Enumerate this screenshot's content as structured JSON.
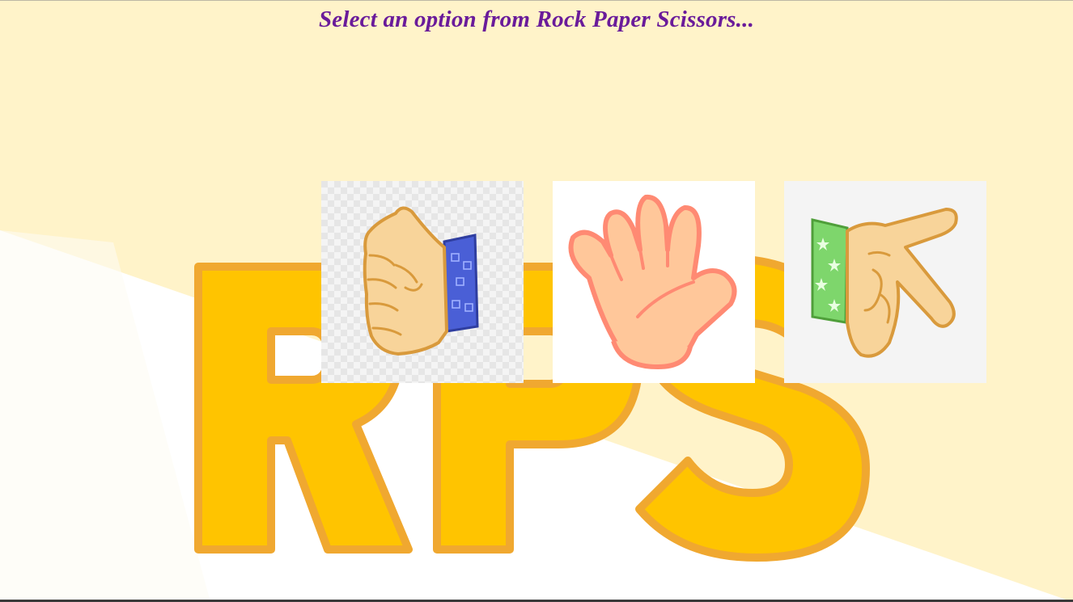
{
  "page": {
    "heading": "Select an option from Rock Paper Scissors...",
    "background_logo_text": "RPS",
    "colors": {
      "heading": "#6a1b9a",
      "background": "#fff3c9",
      "logo": "#ffc400",
      "logo_outline": "#f5a623"
    }
  },
  "choices": [
    {
      "id": "rock",
      "image": "fist-hand-icon"
    },
    {
      "id": "paper",
      "image": "open-hand-icon"
    },
    {
      "id": "scissors",
      "image": "victory-hand-icon"
    }
  ]
}
